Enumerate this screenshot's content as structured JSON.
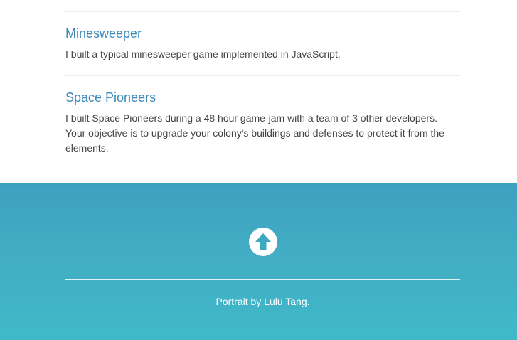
{
  "projects": [
    {
      "title": "Minesweeper",
      "description": "I built a typical minesweeper game implemented in JavaScript."
    },
    {
      "title": "Space Pioneers",
      "description_lines": [
        "I built Space Pioneers during a 48 hour game-jam with a team of 3 other developers.",
        "Your objective is to upgrade your colony's buildings and defenses to protect it from the",
        "elements."
      ]
    }
  ],
  "footer": {
    "scroll_top_icon": "arrow-up-circle-icon",
    "credit": "Portrait by Lulu Tang.",
    "colors": {
      "background_top": "#3ea0bf",
      "background_bottom": "#3fb9c8",
      "link": "#3f88b8"
    }
  }
}
